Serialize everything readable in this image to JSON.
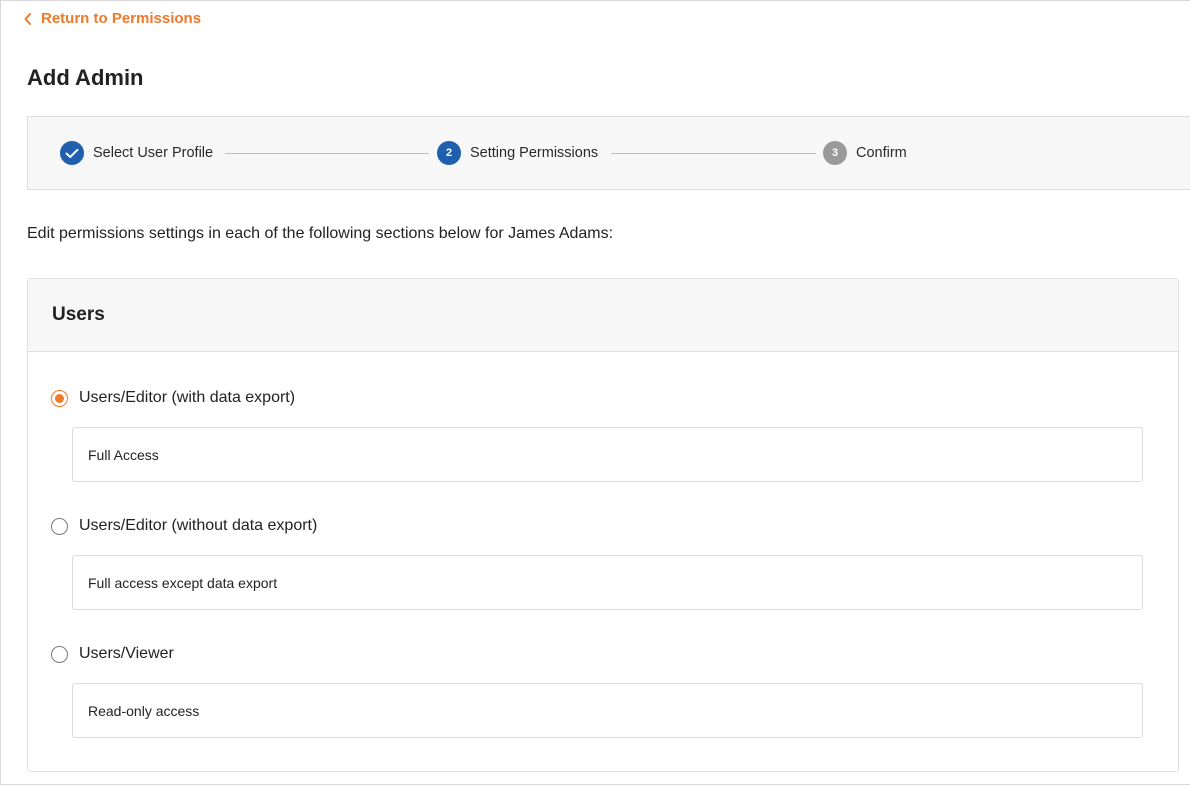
{
  "nav": {
    "back_label": "Return to Permissions"
  },
  "page": {
    "title": "Add Admin",
    "instructions": "Edit permissions settings in each of the following sections below for James Adams:"
  },
  "stepper": {
    "steps": [
      {
        "number": "",
        "label": "Select User Profile",
        "state": "completed"
      },
      {
        "number": "2",
        "label": "Setting Permissions",
        "state": "active"
      },
      {
        "number": "3",
        "label": "Confirm",
        "state": "pending"
      }
    ]
  },
  "users_section": {
    "title": "Users",
    "options": [
      {
        "label": "Users/Editor (with data export)",
        "description": "Full Access",
        "selected": true
      },
      {
        "label": "Users/Editor (without data export)",
        "description": "Full access except data export",
        "selected": false
      },
      {
        "label": "Users/Viewer",
        "description": "Read-only access",
        "selected": false
      }
    ]
  },
  "colors": {
    "accent": "#ee7a2b",
    "step_active": "#1f5fae",
    "step_pending": "#9a9a9a"
  }
}
